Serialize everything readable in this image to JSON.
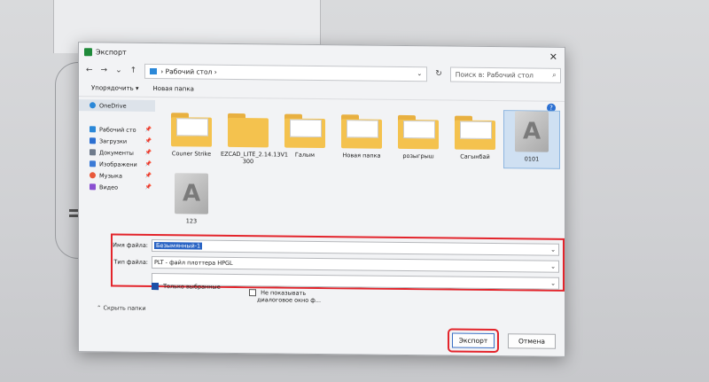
{
  "dialog": {
    "title": "Экспорт",
    "close_glyph": "✕"
  },
  "nav": {
    "back": "←",
    "forward": "→",
    "dropdown": "⌄",
    "up": "↑",
    "address": "› Рабочий стол ›",
    "address_dropdown": "⌄",
    "refresh": "↻",
    "search_placeholder": "Поиск в: Рабочий стол",
    "search_glyph": "⌕"
  },
  "toolbar": {
    "organize": "Упорядочить ▾",
    "new_folder": "Новая папка",
    "help": "?"
  },
  "sidebar": {
    "items": [
      {
        "label": "OneDrive",
        "color": "#2b88d8",
        "pin": ""
      },
      {
        "label": "Рабочий сто",
        "color": "#2b88d8",
        "pin": "📌"
      },
      {
        "label": "Загрузки",
        "color": "#2b6fd1",
        "pin": "📌"
      },
      {
        "label": "Документы",
        "color": "#6f7b8c",
        "pin": "📌"
      },
      {
        "label": "Изображени",
        "color": "#3b7ad6",
        "pin": "📌"
      },
      {
        "label": "Музыка",
        "color": "#e8583a",
        "pin": "📌"
      },
      {
        "label": "Видео",
        "color": "#8a4fd1",
        "pin": "📌"
      }
    ]
  },
  "files": [
    {
      "name": "Couner Strike",
      "kind": "folder"
    },
    {
      "name": "EZCAD_LITE_2.14.13V1  300",
      "kind": "folder"
    },
    {
      "name": "Галым",
      "kind": "folder"
    },
    {
      "name": "Новая папка",
      "kind": "folder"
    },
    {
      "name": "розыгрыш",
      "kind": "folder"
    },
    {
      "name": "Сагынбай",
      "kind": "folder"
    },
    {
      "name": "0101",
      "kind": "autodesk"
    },
    {
      "name": "123",
      "kind": "autodesk"
    }
  ],
  "form": {
    "filename_label": "Имя файла:",
    "filename_value": "Безымянный-1",
    "filetype_label": "Тип файла:",
    "filetype_value": "PLT - файл плоттера HPGL",
    "dropdown": "⌄"
  },
  "options": {
    "only_selected": "Только выбранные",
    "no_show": "Не показывать",
    "no_show_line2": "диалоговое окно ф..."
  },
  "footer": {
    "hide_folders": "⌃ Скрыть папки",
    "export": "Экспорт",
    "cancel": "Отмена"
  },
  "colors": {
    "highlight_red": "#e3242b",
    "selection_blue": "#2a64c4",
    "folder_yellow": "#f4c24e"
  }
}
